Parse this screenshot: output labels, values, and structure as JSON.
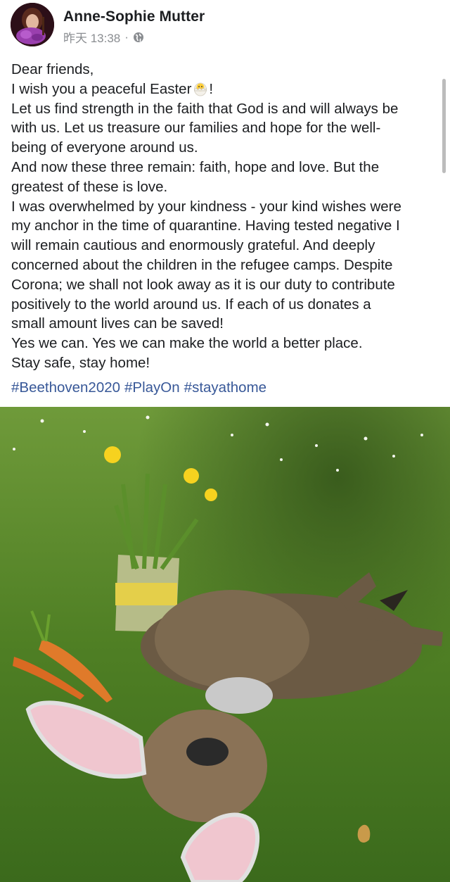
{
  "post": {
    "author": "Anne-Sophie Mutter",
    "timestamp": "昨天 13:38",
    "separator": "·",
    "privacy_icon": "globe-icon",
    "lines": [
      "Dear friends,",
      "I wish you a peaceful Easter",
      "Let us find strength in the faith that God is and will always be",
      "with us. Let us treasure our families and hope for the well-",
      "being of everyone around us.",
      "And now these three remain: faith, hope and love. But the",
      "greatest of these is love.",
      "I was overwhelmed by your kindness - your kind wishes were",
      "my anchor in the time of quarantine. Having tested negative I",
      "will remain cautious and enormously grateful. And deeply",
      "concerned about the children in the refugee camps. Despite",
      "Corona; we shall not look away as it is our duty to contribute",
      "positively to the world around us. If each of us donates a",
      "small amount lives can be saved!",
      "Yes we can. Yes we can make the world a better place.",
      "Stay safe, stay home!"
    ],
    "easter_suffix": "!",
    "emoji_icon": "hatching-chick-icon",
    "hashtags": [
      "#Beethoven2020",
      "#PlayOn",
      "#stayathome"
    ]
  },
  "colors": {
    "text": "#1c1e21",
    "meta": "#8a8d91",
    "hashtag": "#385898",
    "background": "#ffffff"
  }
}
